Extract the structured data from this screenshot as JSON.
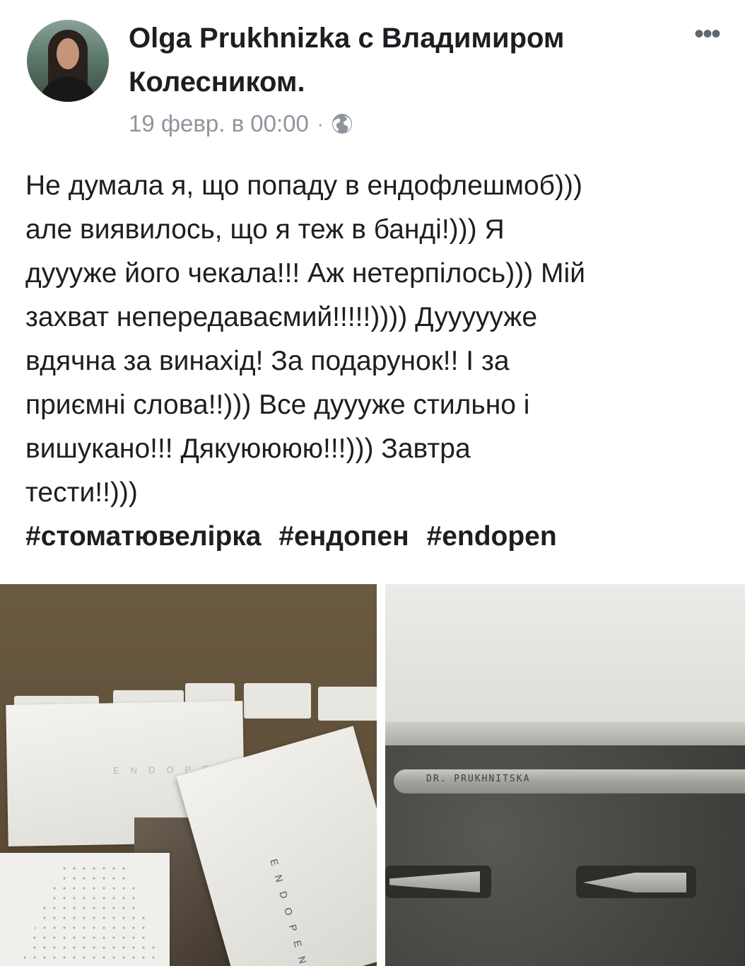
{
  "post": {
    "author_line1": "Olga Prukhnizka с Владимиром",
    "author_line2": "Колесником.",
    "timestamp": "19 февр. в 00:00",
    "separator": "·",
    "more_icon": "•••",
    "privacy_icon": "globe-icon",
    "text_lines": [
      "Не думала я, що попаду в ендофлешмоб)))",
      "але виявилось, що я теж в банді!))) Я",
      "дуууже його чекала!!! Аж нетерпілось))) Мій",
      "захват непередаваємий!!!!!)))) Дуууууже",
      "вдячна за винахід! За подарунок!! І за",
      "приємні слова!!))) Все дуууже стильно і",
      "вишукано!!! Дякуюююю!!!))) Завтра",
      "тести!!)))"
    ],
    "hashtags": [
      "#стоматювелірка",
      "#ендопен",
      "#endopen"
    ]
  },
  "photos": {
    "left_box_text": "ENDOPEN",
    "left_lid_text": "ENDOPEN",
    "pen_engraving": "DR. PRUKHNITSKA"
  },
  "colors": {
    "text": "#1c1e21",
    "meta": "#90949c",
    "icon": "#606770"
  }
}
